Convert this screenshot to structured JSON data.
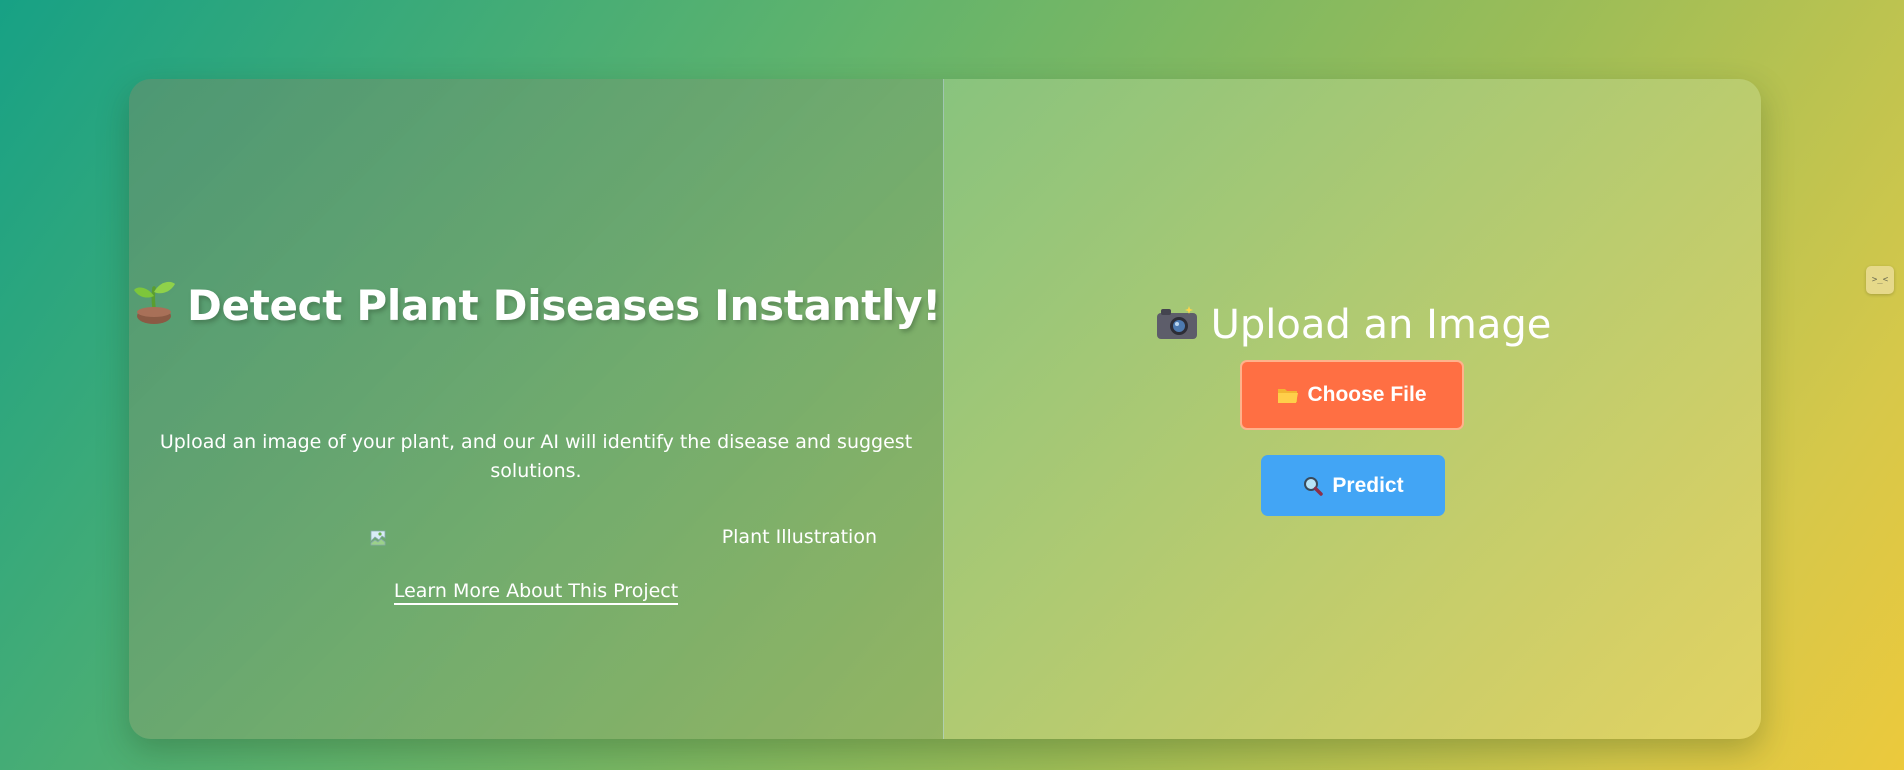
{
  "hero": {
    "title": "Detect Plant Diseases Instantly!",
    "title_icon": "sprout-icon",
    "subtitle": "Upload an image of your plant, and our AI will identify the disease and suggest solutions.",
    "illustration_alt": "Plant Illustration",
    "learn_more_label": "Learn More About This Project"
  },
  "upload": {
    "title": "Upload an Image",
    "title_icon": "camera-icon",
    "choose_file_label": "Choose File",
    "choose_file_icon": "folder-icon",
    "predict_label": "Predict",
    "predict_icon": "magnifier-icon"
  },
  "side_widget": {
    "label": ">_<",
    "icon": "extension-face-icon"
  },
  "colors": {
    "choose_file_bg": "#ff6f43",
    "predict_bg": "#42a5f5",
    "text": "#ffffff"
  }
}
